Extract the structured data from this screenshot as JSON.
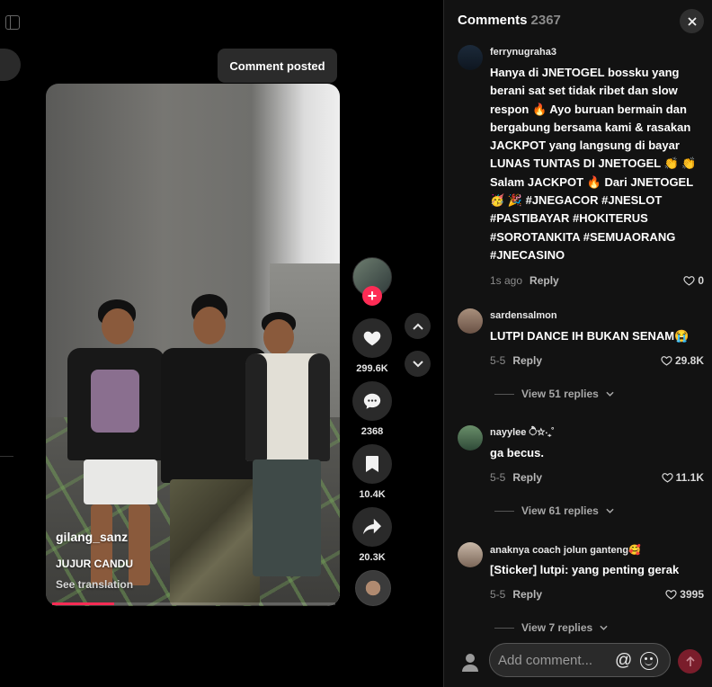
{
  "toast": {
    "text": "Comment posted"
  },
  "video": {
    "username": "gilang_sanz",
    "description": "JUJUR CANDU",
    "see_translation": "See translation",
    "progress_fraction": 0.22
  },
  "actions": {
    "likes": "299.6K",
    "comments": "2368",
    "bookmarks": "10.4K",
    "shares": "20.3K"
  },
  "panel": {
    "title": "Comments",
    "count": "2367"
  },
  "comments": [
    {
      "user": "ferrynugraha3",
      "text": "Hanya di JNETOGEL bossku yang berani sat set tidak ribet dan slow respon 🔥 Ayo buruan bermain dan bergabung bersama kami & rasakan JACKPOT yang langsung di bayar LUNAS TUNTAS DI JNETOGEL 👏 👏 Salam JACKPOT 🔥 Dari JNETOGEL 🥳 🎉 #JNEGACOR #JNESLOT #PASTIBAYAR #HOKITERUS #SOROTANKITA #SEMUAORANG #JNECASINO",
      "time": "1s ago",
      "reply": "Reply",
      "likes": "0"
    },
    {
      "user": "sardensalmon",
      "text": "LUTPI DANCE IH BUKAN SENAM😭",
      "time": "5-5",
      "reply": "Reply",
      "likes": "29.8K",
      "view_replies": "View 51 replies"
    },
    {
      "user": "nayylee ੈ✩‧₊˚",
      "text": "ga becus.",
      "time": "5-5",
      "reply": "Reply",
      "likes": "11.1K",
      "view_replies": "View 61 replies"
    },
    {
      "user": "anaknya coach jolun ganteng🥰",
      "text": "[Sticker] lutpi: yang penting gerak",
      "time": "5-5",
      "reply": "Reply",
      "likes": "3995",
      "view_replies": "View 7 replies"
    }
  ],
  "composer": {
    "placeholder": "Add comment..."
  },
  "colors": {
    "accent": "#fe2c55",
    "panel_bg": "#121212",
    "send_disabled": "#7a1d2b"
  }
}
